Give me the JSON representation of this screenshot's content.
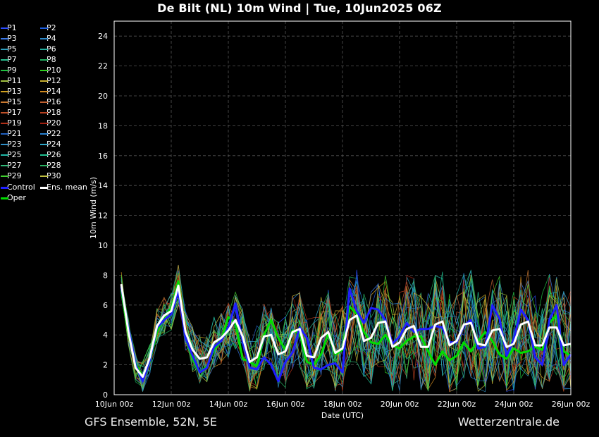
{
  "header": {
    "title": "De Bilt  (NL)  10m Wind | Tue, 10Jun2025 06Z"
  },
  "footer": {
    "left": "GFS Ensemble, 52N, 5E",
    "right": "Wetterzentrale.de"
  },
  "legend": [
    {
      "label": "P1",
      "color": "#2a4cff"
    },
    {
      "label": "P2",
      "color": "#1e5ee0"
    },
    {
      "label": "P3",
      "color": "#3a78e8"
    },
    {
      "label": "P4",
      "color": "#2d88c8"
    },
    {
      "label": "P5",
      "color": "#2ea0c0"
    },
    {
      "label": "P6",
      "color": "#22b0a0"
    },
    {
      "label": "P7",
      "color": "#28c090"
    },
    {
      "label": "P8",
      "color": "#20b060"
    },
    {
      "label": "P9",
      "color": "#20c040"
    },
    {
      "label": "P10",
      "color": "#30d020"
    },
    {
      "label": "P11",
      "color": "#a0c040"
    },
    {
      "label": "P12",
      "color": "#c8b030"
    },
    {
      "label": "P13",
      "color": "#d0a020"
    },
    {
      "label": "P14",
      "color": "#d08a20"
    },
    {
      "label": "P15",
      "color": "#c87830"
    },
    {
      "label": "P16",
      "color": "#c06030"
    },
    {
      "label": "P17",
      "color": "#c05028"
    },
    {
      "label": "P18",
      "color": "#b84020"
    },
    {
      "label": "P19",
      "color": "#b03018"
    },
    {
      "label": "P20",
      "color": "#a02010"
    },
    {
      "label": "P21",
      "color": "#2060c0"
    },
    {
      "label": "P22",
      "color": "#2880d0"
    },
    {
      "label": "P23",
      "color": "#3090c8"
    },
    {
      "label": "P24",
      "color": "#30a8c8"
    },
    {
      "label": "P25",
      "color": "#20b8a8"
    },
    {
      "label": "P26",
      "color": "#20c090"
    },
    {
      "label": "P27",
      "color": "#30b878"
    },
    {
      "label": "P28",
      "color": "#28b060"
    },
    {
      "label": "P29",
      "color": "#40d030"
    },
    {
      "label": "P30",
      "color": "#c0c040"
    },
    {
      "label": "Control",
      "color": "#1f1fff"
    },
    {
      "label": "Ens. mean",
      "color": "#ffffff"
    },
    {
      "label": "Oper",
      "color": "#00dd00"
    }
  ],
  "chart_data": {
    "type": "line",
    "xlabel": "Date (UTC)",
    "ylabel": "10m Wind (m/s)",
    "ylim": [
      0,
      25
    ],
    "yticks": [
      0,
      2,
      4,
      6,
      8,
      10,
      12,
      14,
      16,
      18,
      20,
      22,
      24
    ],
    "xticks": [
      "10Jun 00z",
      "12Jun 00z",
      "14Jun 00z",
      "16Jun 00z",
      "18Jun 00z",
      "20Jun 00z",
      "22Jun 00z",
      "24Jun 00z",
      "26Jun 00z"
    ],
    "x_step_hours": 6,
    "x_start": "10Jun2025 06Z",
    "grid": true,
    "series": [
      {
        "name": "Ens. mean",
        "color": "#ffffff",
        "values": [
          7.4,
          4.2,
          1.8,
          1.2,
          2.5,
          4.6,
          5.3,
          5.6,
          7.3,
          4.2,
          3.0,
          2.4,
          2.5,
          3.5,
          3.8,
          4.3,
          5.0,
          3.9,
          2.2,
          2.5,
          3.9,
          4.0,
          2.7,
          2.9,
          4.2,
          4.4,
          2.6,
          2.5,
          3.8,
          4.2,
          2.8,
          3.1,
          5.0,
          5.3,
          3.6,
          3.8,
          4.8,
          4.9,
          3.2,
          3.5,
          4.4,
          4.6,
          3.2,
          3.2,
          4.7,
          4.9,
          3.3,
          3.6,
          4.7,
          4.8,
          3.4,
          3.3,
          4.3,
          4.4,
          3.2,
          3.4,
          4.7,
          4.9,
          3.3,
          3.3,
          4.5,
          4.5,
          3.3,
          3.4
        ]
      },
      {
        "name": "Control",
        "color": "#1f1fff",
        "values": [
          7.2,
          4.4,
          2.0,
          0.9,
          2.3,
          4.5,
          5.0,
          5.4,
          6.9,
          3.8,
          2.6,
          1.5,
          1.8,
          3.2,
          3.6,
          4.5,
          6.1,
          3.6,
          1.8,
          1.7,
          2.5,
          2.0,
          0.9,
          2.2,
          2.8,
          4.5,
          3.8,
          1.8,
          1.7,
          2.0,
          2.1,
          1.5,
          7.1,
          5.6,
          4.8,
          5.8,
          5.7,
          5.0,
          3.4,
          3.9,
          4.8,
          4.2,
          4.4,
          4.4,
          4.6,
          4.5,
          3.5,
          3.5,
          4.6,
          5.0,
          3.1,
          3.2,
          6.0,
          5.1,
          2.6,
          3.7,
          5.7,
          5.0,
          2.5,
          2.0,
          5.0,
          6.0,
          2.0,
          2.7
        ]
      },
      {
        "name": "Oper",
        "color": "#00dd00",
        "values": [
          7.0,
          4.0,
          2.1,
          1.2,
          2.2,
          4.2,
          5.2,
          5.8,
          7.6,
          3.8,
          2.4,
          1.5,
          1.9,
          3.0,
          3.6,
          5.2,
          4.8,
          2.4,
          2.2,
          1.9,
          4.0,
          5.0,
          3.8,
          3.0,
          4.3,
          4.1,
          2.2,
          2.0,
          2.7,
          4.1,
          2.7,
          3.0,
          5.9,
          5.4,
          4.2,
          3.5,
          3.4,
          4.0,
          3.3,
          3.1,
          3.6,
          3.9,
          3.9,
          2.9,
          2.0,
          2.9,
          2.3,
          2.6,
          3.5,
          2.9,
          3.6,
          4.2,
          3.6,
          2.7,
          2.4,
          3.1,
          2.8,
          2.9,
          3.2,
          3.0,
          4.8,
          5.3,
          2.9,
          2.6
        ]
      }
    ]
  }
}
